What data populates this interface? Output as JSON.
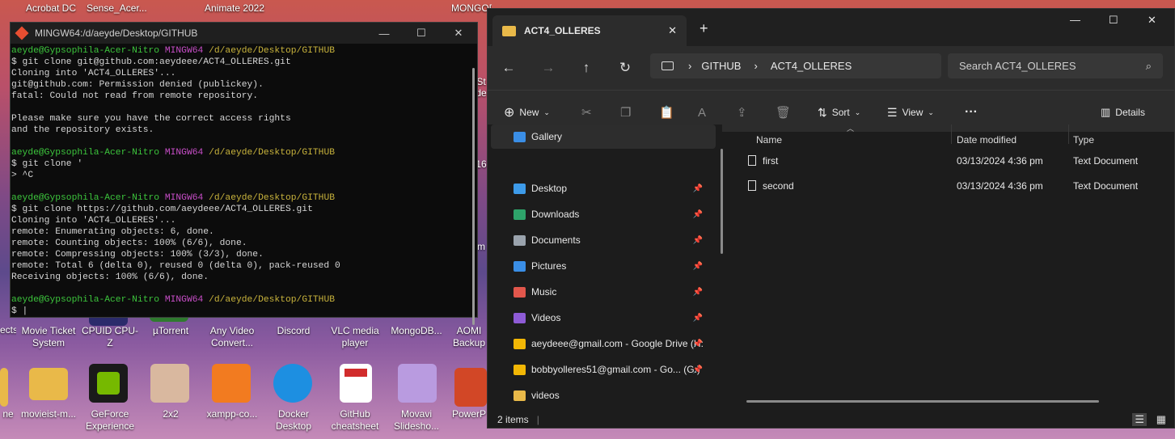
{
  "desktop": {
    "top_labels": [
      "Acrobat DC",
      "Sense_Acer...",
      "Animate 2022",
      "MONGODB"
    ],
    "icons_row1": [
      "Movie Ticket System",
      "CPUID CPU-Z",
      "µTorrent",
      "Any Video Convert...",
      "Discord",
      "VLC media player",
      "MongoDB...",
      "AOMI Backup"
    ],
    "icons_row2": [
      "movieist-m...",
      "GeForce Experience",
      "2x2",
      "xampp-co...",
      "Docker Desktop",
      "GitHub cheatsheet",
      "Movavi Slidesho...",
      "PowerP"
    ],
    "side_labels": [
      "ects",
      "ne",
      "St",
      "de",
      "16",
      "m"
    ]
  },
  "terminal": {
    "title": "MINGW64:/d/aeyde/Desktop/GITHUB",
    "prompt_user": "aeyde@Gypsophila-Acer-Nitro",
    "prompt_env": "MINGW64",
    "prompt_path": "/d/aeyde/Desktop/GITHUB",
    "block1": [
      "$ git clone git@github.com:aeydeee/ACT4_OLLERES.git",
      "Cloning into 'ACT4_OLLERES'...",
      "git@github.com: Permission denied (publickey).",
      "fatal: Could not read from remote repository.",
      "",
      "Please make sure you have the correct access rights",
      "and the repository exists.",
      ""
    ],
    "block2": [
      "$ git clone '",
      "> ^C",
      ""
    ],
    "block3": [
      "$ git clone https://github.com/aeydeee/ACT4_OLLERES.git",
      "Cloning into 'ACT4_OLLERES'...",
      "remote: Enumerating objects: 6, done.",
      "remote: Counting objects: 100% (6/6), done.",
      "remote: Compressing objects: 100% (3/3), done.",
      "remote: Total 6 (delta 0), reused 0 (delta 0), pack-reused 0",
      "Receiving objects: 100% (6/6), done.",
      ""
    ],
    "block4": [
      "$ |"
    ]
  },
  "explorer": {
    "tab_title": "ACT4_OLLERES",
    "new_tab": "+",
    "breadcrumb": [
      "GITHUB",
      "ACT4_OLLERES"
    ],
    "search_placeholder": "Search ACT4_OLLERES",
    "toolbar": {
      "new": "New",
      "sort": "Sort",
      "view": "View",
      "more": "···",
      "details": "Details"
    },
    "nav": [
      {
        "label": "Gallery",
        "icon": "gallery-icon",
        "color": "#3a8ee6",
        "pinned": false
      },
      {
        "label": "Desktop",
        "icon": "desktop-icon",
        "color": "#3d9be9",
        "pinned": true
      },
      {
        "label": "Downloads",
        "icon": "downloads-icon",
        "color": "#2ea36a",
        "pinned": true
      },
      {
        "label": "Documents",
        "icon": "documents-icon",
        "color": "#9aa3ad",
        "pinned": true
      },
      {
        "label": "Pictures",
        "icon": "pictures-icon",
        "color": "#3a8ee6",
        "pinned": true
      },
      {
        "label": "Music",
        "icon": "music-icon",
        "color": "#e2574c",
        "pinned": true
      },
      {
        "label": "Videos",
        "icon": "videos-icon",
        "color": "#8e5bd6",
        "pinned": true
      },
      {
        "label": "aeydeee@gmail.com - Google Drive (H:)",
        "icon": "google-drive-icon",
        "color": "#f2b705",
        "pinned": true
      },
      {
        "label": "bobbyolleres51@gmail.com - Go... (G:)",
        "icon": "google-drive-icon",
        "color": "#f2b705",
        "pinned": true
      },
      {
        "label": "videos",
        "icon": "folder-icon",
        "color": "#e9b949",
        "pinned": false
      }
    ],
    "columns": {
      "name": "Name",
      "date": "Date modified",
      "type": "Type"
    },
    "files": [
      {
        "name": "first",
        "date": "03/13/2024 4:36 pm",
        "type": "Text Document"
      },
      {
        "name": "second",
        "date": "03/13/2024 4:36 pm",
        "type": "Text Document"
      }
    ],
    "status": "2 items"
  }
}
